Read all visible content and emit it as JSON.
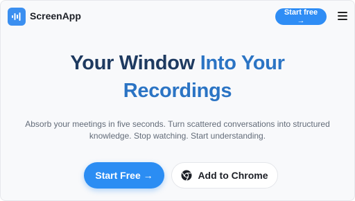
{
  "header": {
    "brand": "ScreenApp",
    "cta_label": "Start free →",
    "logo_icon": "sound-wave-icon",
    "menu_icon": "hamburger-menu-icon"
  },
  "hero": {
    "headline_part1": "Your Window ",
    "headline_accent": "Into Your",
    "headline_part2": "Recordings",
    "subtext": "Absorb your meetings in five seconds. Turn scattered conversations into structured knowledge. Stop watching. Start understanding."
  },
  "actions": {
    "primary_label": "Start Free →",
    "secondary_label": "Add to Chrome",
    "secondary_icon": "chrome-icon"
  },
  "colors": {
    "accent": "#2b8df3",
    "heading": "#1e3a60",
    "heading_accent": "#2b74c4"
  }
}
